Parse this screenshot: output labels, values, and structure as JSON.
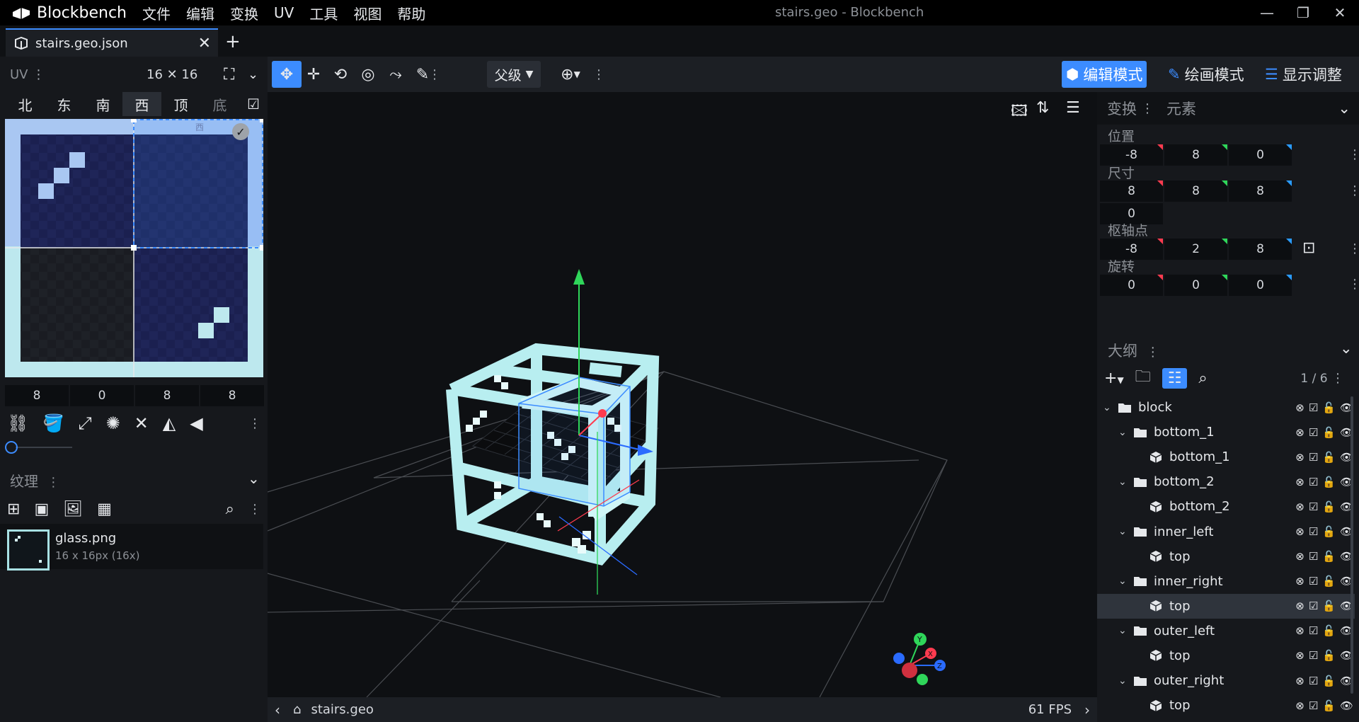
{
  "app": {
    "name": "Blockbench",
    "window_title": "stairs.geo - Blockbench",
    "menu": [
      "文件",
      "编辑",
      "变换",
      "UV",
      "工具",
      "视图",
      "帮助"
    ]
  },
  "tab": {
    "label": "stairs.geo.json",
    "close": "✕",
    "new": "+"
  },
  "uv_panel": {
    "title": "UV",
    "size": "16 ✕ 16",
    "faces": [
      "北",
      "东",
      "南",
      "西",
      "顶",
      "底"
    ],
    "active_face": "西",
    "face_overlay_label": "西",
    "values": [
      "8",
      "0",
      "8",
      "8"
    ]
  },
  "textures": {
    "title": "纹理",
    "items": [
      {
        "name": "glass.png",
        "size": "16 x 16px (16x)"
      }
    ]
  },
  "toolbar": {
    "parent_select": "父级",
    "modes": [
      {
        "label": "编辑模式",
        "icon": "cube-icon",
        "active": true
      },
      {
        "label": "绘画模式",
        "icon": "brush-icon",
        "active": false
      },
      {
        "label": "显示调整",
        "icon": "sliders-icon",
        "active": false
      }
    ]
  },
  "properties": {
    "tabs": [
      "变换",
      "元素"
    ],
    "position": {
      "label": "位置",
      "values": [
        "-8",
        "8",
        "0"
      ]
    },
    "size": {
      "label": "尺寸",
      "values": [
        "8",
        "8",
        "8"
      ],
      "inflate": "0"
    },
    "pivot": {
      "label": "枢轴点",
      "values": [
        "-8",
        "2",
        "8"
      ]
    },
    "rotation": {
      "label": "旋转",
      "values": [
        "0",
        "0",
        "0"
      ]
    }
  },
  "outliner": {
    "title": "大纲",
    "count": "1 / 6",
    "items": [
      {
        "name": "block",
        "type": "group",
        "depth": 0
      },
      {
        "name": "bottom_1",
        "type": "group",
        "depth": 1
      },
      {
        "name": "bottom_1",
        "type": "cube",
        "depth": 2
      },
      {
        "name": "bottom_2",
        "type": "group",
        "depth": 1
      },
      {
        "name": "bottom_2",
        "type": "cube",
        "depth": 2
      },
      {
        "name": "inner_left",
        "type": "group",
        "depth": 1
      },
      {
        "name": "top",
        "type": "cube",
        "depth": 2
      },
      {
        "name": "inner_right",
        "type": "group",
        "depth": 1
      },
      {
        "name": "top",
        "type": "cube",
        "depth": 2,
        "selected": true
      },
      {
        "name": "outer_left",
        "type": "group",
        "depth": 1
      },
      {
        "name": "top",
        "type": "cube",
        "depth": 2
      },
      {
        "name": "outer_right",
        "type": "group",
        "depth": 1
      },
      {
        "name": "top",
        "type": "cube",
        "depth": 2
      }
    ]
  },
  "status": {
    "model": "stairs.geo",
    "fps": "61 FPS"
  },
  "colors": {
    "accent": "#3c8cff",
    "glass": "#b8eef0",
    "x_axis": "#ff3b4f",
    "y_axis": "#2fd65a",
    "z_axis": "#2a6bff"
  }
}
